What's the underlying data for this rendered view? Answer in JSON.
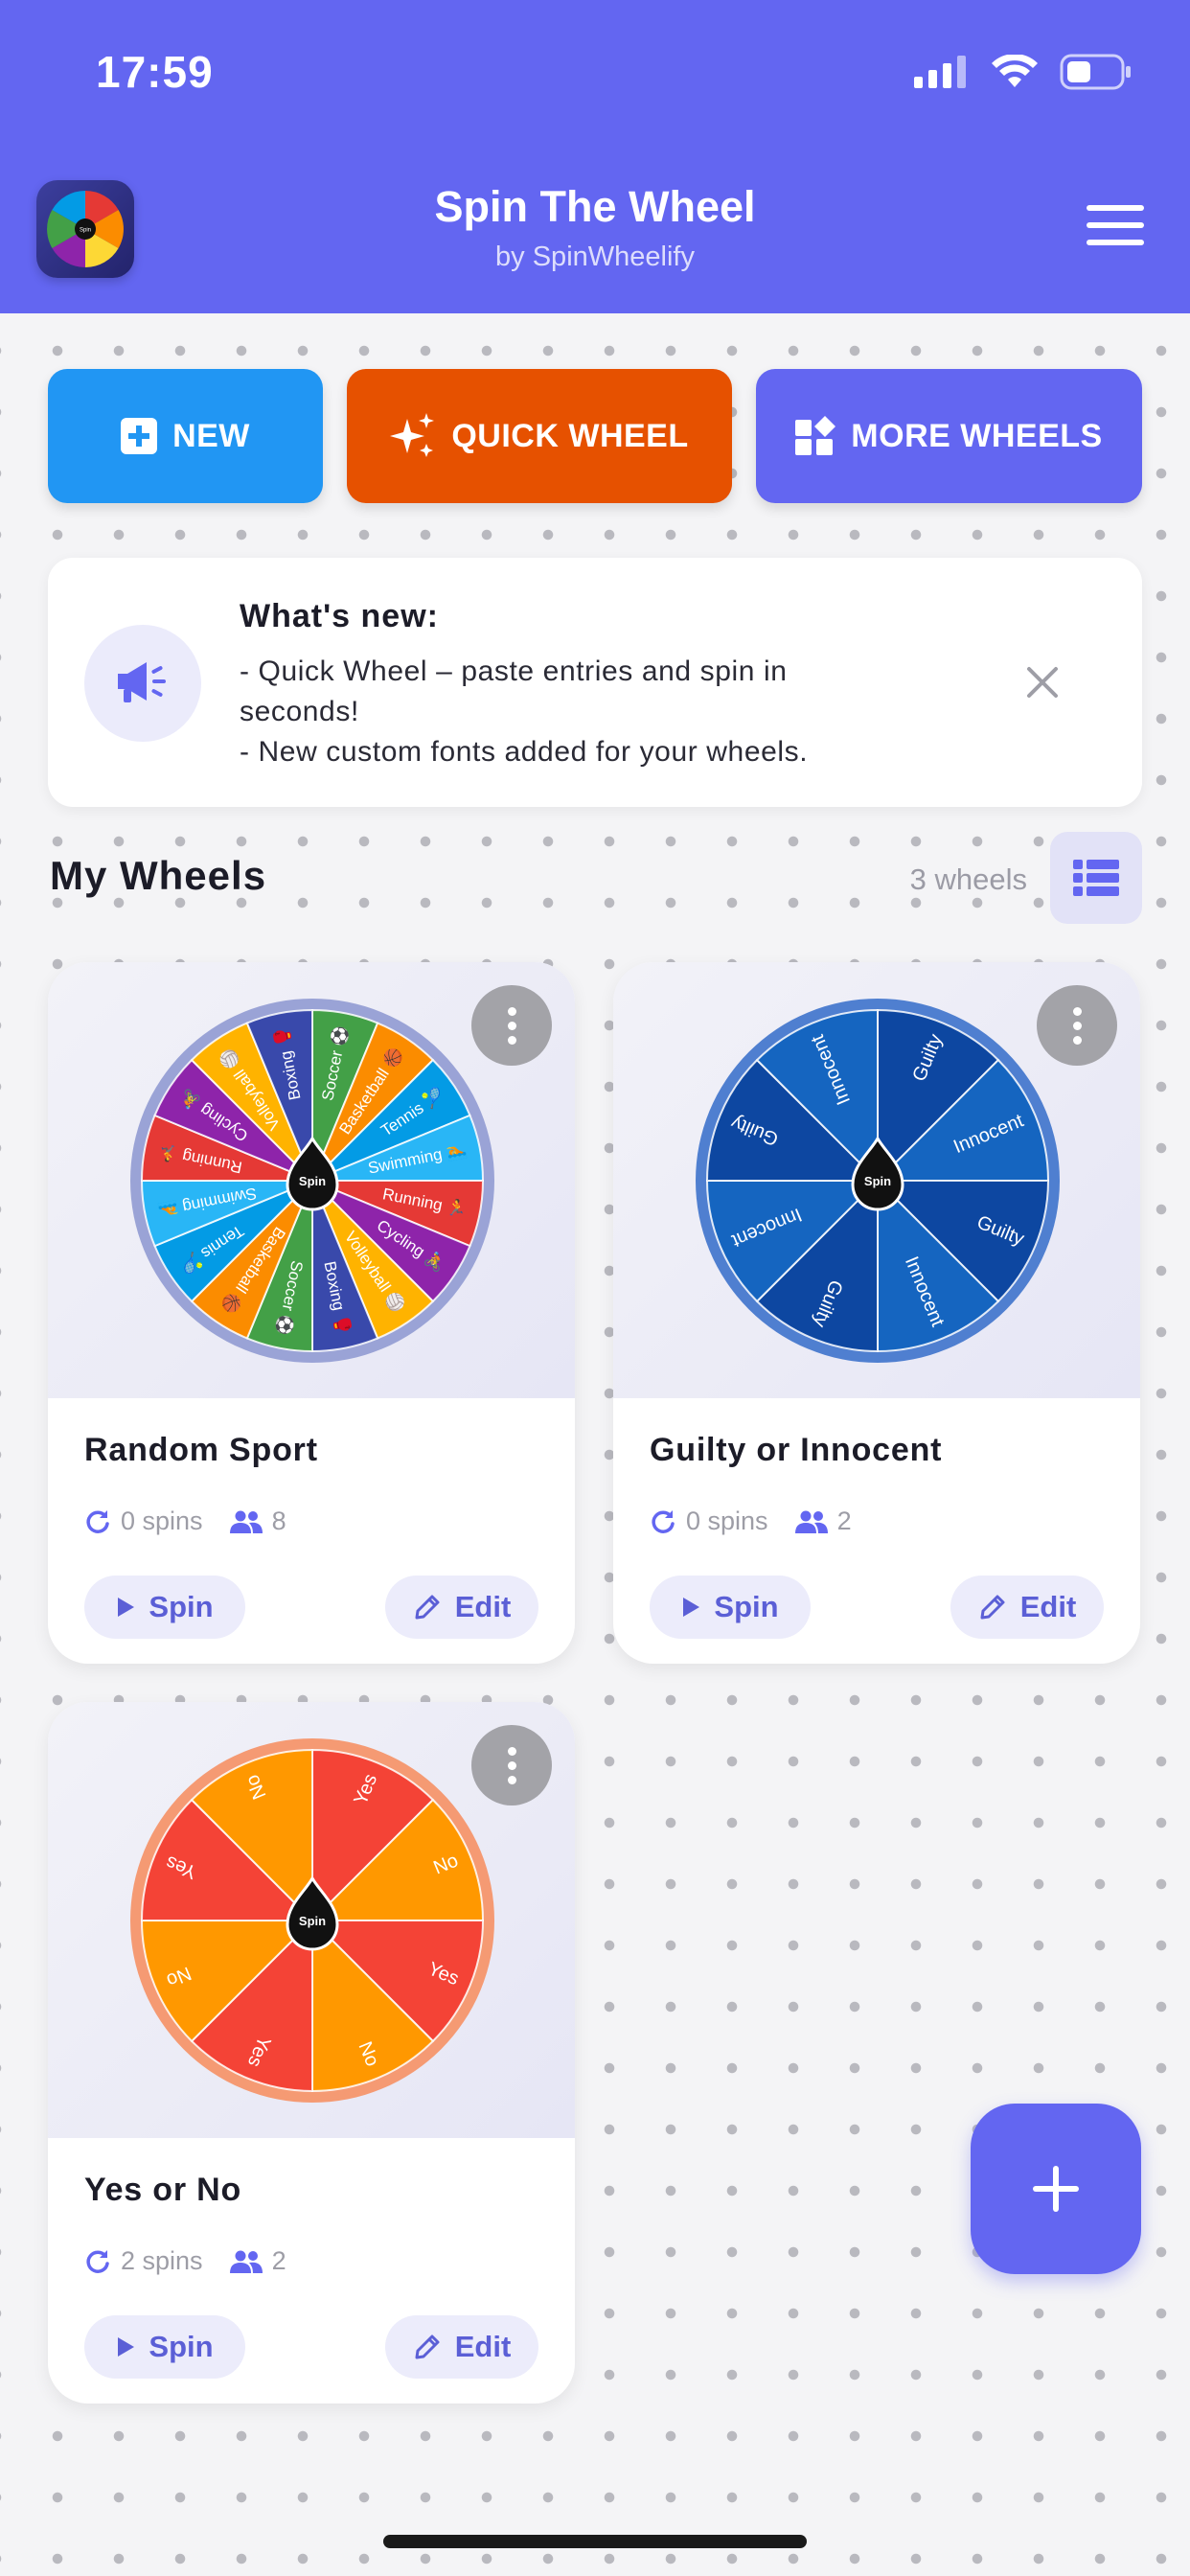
{
  "status_bar": {
    "time": "17:59"
  },
  "app": {
    "title": "Spin The Wheel",
    "subtitle": "by SpinWheelify",
    "logo_center_text": "Spin"
  },
  "actions": {
    "new_label": "NEW",
    "quick_label": "QUICK WHEEL",
    "more_label": "MORE WHEELS"
  },
  "news": {
    "title": "What's new:",
    "line1": "- Quick Wheel – paste entries and spin in seconds!",
    "line2": "- New custom fonts added for your wheels."
  },
  "section": {
    "title": "My Wheels",
    "count": "3 wheels"
  },
  "wheels": [
    {
      "name": "Random Sport",
      "spins": "0 spins",
      "entries": "8",
      "spin_label": "Spin",
      "edit_label": "Edit",
      "hub_label": "Spin",
      "segments": [
        "Soccer ⚽",
        "Basketball 🏀",
        "Tennis 🎾",
        "Swimming 🏊",
        "Running 🏃",
        "Cycling 🚴",
        "Volleyball 🏐",
        "Boxing 🥊",
        "Soccer ⚽",
        "Basketball 🏀",
        "Tennis 🎾",
        "Swimming 🏊",
        "Running 🏃",
        "Cycling 🚴",
        "Volleyball 🏐",
        "Boxing 🥊"
      ],
      "colors": [
        "#43a047",
        "#fb8c00",
        "#039be5",
        "#29b6f6",
        "#e53935",
        "#8e24aa",
        "#ffb300",
        "#3949ab"
      ],
      "rim_color": "#9aa3d6"
    },
    {
      "name": "Guilty or Innocent",
      "spins": "0 spins",
      "entries": "2",
      "spin_label": "Spin",
      "edit_label": "Edit",
      "hub_label": "Spin",
      "segments": [
        "Guilty",
        "Innocent",
        "Guilty",
        "Innocent",
        "Guilty",
        "Innocent",
        "Guilty",
        "Innocent"
      ],
      "colors": [
        "#0d47a1",
        "#1565c0"
      ],
      "rim_color": "#4f7fd0"
    },
    {
      "name": "Yes or No",
      "spins": "2 spins",
      "entries": "2",
      "spin_label": "Spin",
      "edit_label": "Edit",
      "hub_label": "Spin",
      "segments": [
        "Yes",
        "No",
        "Yes",
        "No",
        "Yes",
        "No",
        "Yes",
        "No"
      ],
      "colors": [
        "#f44336",
        "#ff9800"
      ],
      "rim_color": "#f59a73"
    }
  ],
  "colors": {
    "primary": "#6366f1",
    "new_button": "#2196f3",
    "quick_button": "#e65100"
  },
  "icons": {
    "new": "plus-square-icon",
    "quick": "sparkles-icon",
    "more": "widgets-icon",
    "news": "megaphone-icon",
    "close": "close-icon",
    "list": "list-icon",
    "spins": "refresh-icon",
    "entries": "people-icon",
    "spin": "play-icon",
    "edit": "pencil-icon",
    "menu": "hamburger-icon",
    "fab": "plus-icon"
  }
}
